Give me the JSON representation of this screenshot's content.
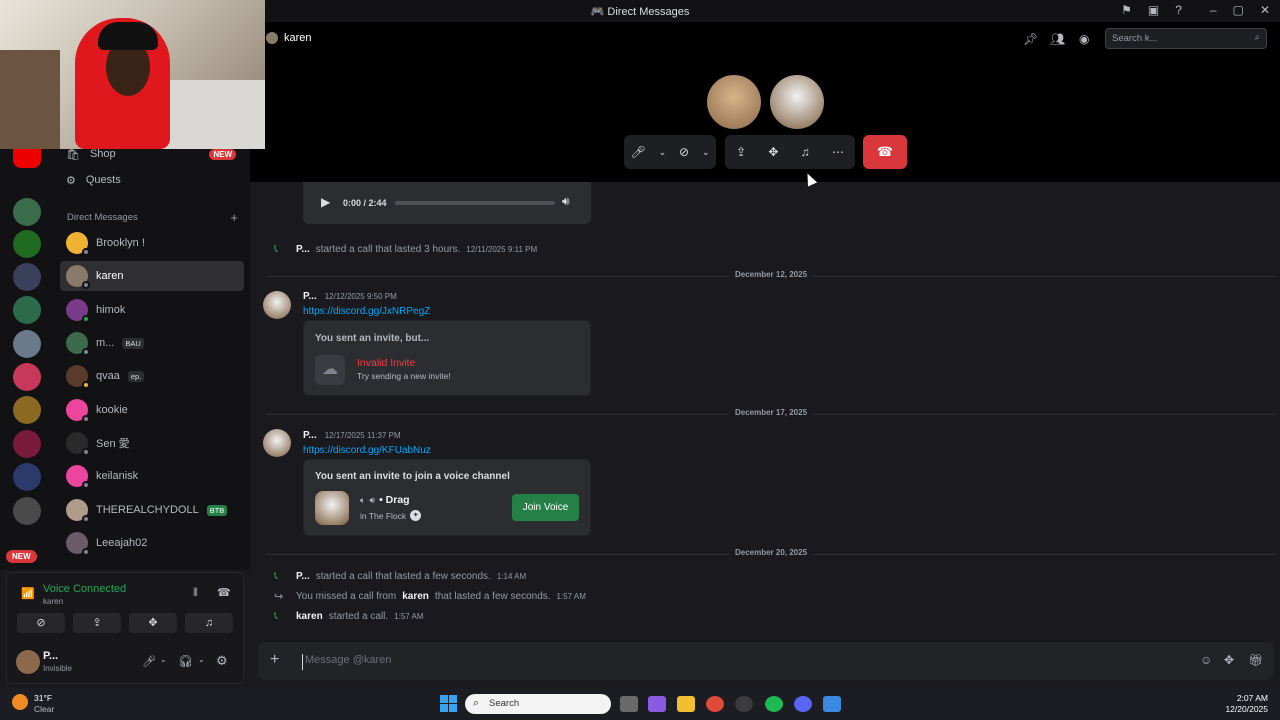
{
  "window": {
    "title": "Direct Messages"
  },
  "sidebar": {
    "shop_label": "Shop",
    "shop_badge": "NEW",
    "quests_label": "Quests",
    "dm_header": "Direct Messages",
    "dm_add": "+",
    "dms": [
      {
        "name": "Brooklyn !",
        "tag": ""
      },
      {
        "name": "karen",
        "tag": ""
      },
      {
        "name": "himok",
        "tag": ""
      },
      {
        "name": "m...",
        "tag": "BAU"
      },
      {
        "name": "qvaa",
        "tag": "ep."
      },
      {
        "name": "kookie",
        "tag": ""
      },
      {
        "name": "Sen 愛",
        "tag": ""
      },
      {
        "name": "keilanisk",
        "tag": ""
      },
      {
        "name": "THEREALCHYDOLL",
        "tag": "BTB"
      },
      {
        "name": "Leeajah02",
        "tag": ""
      }
    ],
    "rail_new_badge": "NEW"
  },
  "voice_panel": {
    "status": "Voice Connected",
    "channel": "karen"
  },
  "user_panel": {
    "name": "P...",
    "status": "Invisible"
  },
  "header": {
    "peer_name": "karen",
    "search_placeholder": "Search k..."
  },
  "chat": {
    "audio": {
      "time": "0:00 / 2:44",
      "progress": 0.0
    },
    "call1": {
      "author": "P...",
      "text": "started a call that lasted 3 hours.",
      "time": "12/11/2025 9:11 PM"
    },
    "date1": "December 12, 2025",
    "msg1": {
      "author": "P...",
      "time": "12/12/2025 9:50 PM",
      "link": "https://discord.gg/JxNRPegZ"
    },
    "invite1": {
      "heading": "You sent an invite, but...",
      "status": "Invalid Invite",
      "hint": "Try sending a new invite!"
    },
    "date2": "December 17, 2025",
    "msg2": {
      "author": "P...",
      "time": "12/17/2025 11:37 PM",
      "link": "https://discord.gg/KFUabNuz"
    },
    "invite2": {
      "heading": "You sent an invite to join a voice channel",
      "channel": "• Drag",
      "server": "in The Flock",
      "button": "Join Voice"
    },
    "date3": "December 20, 2025",
    "call2": {
      "author": "P...",
      "text": "started a call that lasted a few seconds.",
      "time": "1:14 AM"
    },
    "call3": {
      "prefix": "You missed a call from",
      "author": "karen",
      "text": "that lasted a few seconds.",
      "time": "1:57 AM"
    },
    "call4": {
      "author": "karen",
      "text": "started a call.",
      "time": "1:57 AM"
    }
  },
  "composer": {
    "placeholder": "Message @karen"
  },
  "taskbar": {
    "weather_temp": "31°F",
    "weather_desc": "Clear",
    "search": "Search",
    "time": "2:07 AM",
    "date": "12/20/2025"
  }
}
